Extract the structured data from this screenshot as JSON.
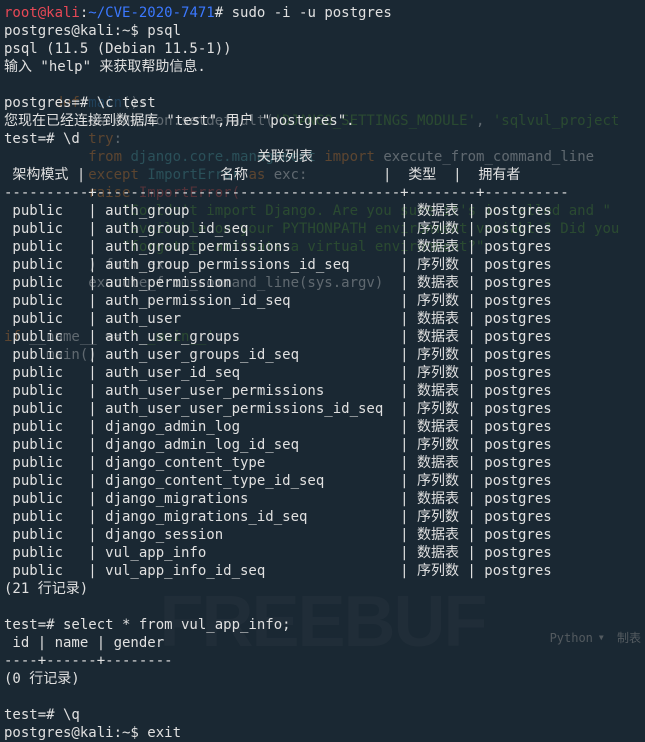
{
  "prompt": {
    "user": "root@kali",
    "sep1": ":",
    "cwd": "~/CVE-2020-7471",
    "sep2": "#",
    "cmd": " sudo -i -u postgres"
  },
  "lines": {
    "l2": "postgres@kali:~$ psql",
    "l3": "psql (11.5 (Debian 11.5-1))",
    "l4": "输入 \"help\" 来获取帮助信息.",
    "l5": "",
    "l6": "postgres=# \\c test",
    "l7": "您现在已经连接到数据库 \"test\",用户 \"postgres\".",
    "l8": "test=# \\d",
    "l9": "                              关联列表",
    "l10": " 架构模式 |                名称                |  类型  |  拥有者  ",
    "l11": "----------+------------------------------------+--------+----------"
  },
  "table": [
    [
      " public   | auth_group                         | 数据表 | postgres"
    ],
    [
      " public   | auth_group_id_seq                  | 序列数 | postgres"
    ],
    [
      " public   | auth_group_permissions             | 数据表 | postgres"
    ],
    [
      " public   | auth_group_permissions_id_seq      | 序列数 | postgres"
    ],
    [
      " public   | auth_permission                    | 数据表 | postgres"
    ],
    [
      " public   | auth_permission_id_seq             | 序列数 | postgres"
    ],
    [
      " public   | auth_user                          | 数据表 | postgres"
    ],
    [
      " public   | auth_user_groups                   | 数据表 | postgres"
    ],
    [
      " public   | auth_user_groups_id_seq            | 序列数 | postgres"
    ],
    [
      " public   | auth_user_id_seq                   | 序列数 | postgres"
    ],
    [
      " public   | auth_user_user_permissions         | 数据表 | postgres"
    ],
    [
      " public   | auth_user_user_permissions_id_seq  | 序列数 | postgres"
    ],
    [
      " public   | django_admin_log                   | 数据表 | postgres"
    ],
    [
      " public   | django_admin_log_id_seq            | 序列数 | postgres"
    ],
    [
      " public   | django_content_type                | 数据表 | postgres"
    ],
    [
      " public   | django_content_type_id_seq         | 序列数 | postgres"
    ],
    [
      " public   | django_migrations                  | 数据表 | postgres"
    ],
    [
      " public   | django_migrations_id_seq           | 序列数 | postgres"
    ],
    [
      " public   | django_session                     | 数据表 | postgres"
    ],
    [
      " public   | vul_app_info                       | 数据表 | postgres"
    ],
    [
      " public   | vul_app_info_id_seq                | 序列数 | postgres"
    ]
  ],
  "after": {
    "a1": "(21 行记录)",
    "a2": "",
    "a3": "test=# select * from vul_app_info;",
    "a4": " id | name | gender ",
    "a5": "----+------+--------",
    "a6": "(0 行记录)",
    "a7": "",
    "a8": "test=# \\q",
    "a9": "postgres@kali:~$ exit"
  },
  "ghost": {
    "g1": "",
    "g2": "",
    "g3": "",
    "g4": "",
    "g5_pre": "      ",
    "g5_kw": "def ",
    "g5_fn": "main",
    "g5_post": "():",
    "g6_a": "          os.environ.setdefault(",
    "g6_s1": "'DJANGO_SETTINGS_MODULE'",
    "g6_b": ", ",
    "g6_s2": "'sqlvul_project",
    "g7_a": "          ",
    "g7_kw": "try",
    "g7_b": ":",
    "g8_a": "          ",
    "g8_kw": "from ",
    "g8_b": "django.core.management ",
    "g8_kw2": "import",
    "g8_c": " execute_from_command_line",
    "g9_a": "          ",
    "g9_kw": "except ",
    "g9_b": "ImportError ",
    "g9_kw2": "as",
    "g9_c": " exc:",
    "g10_a": "          ",
    "g10_kw": "raise ",
    "g10_b": "ImportError(",
    "g11": "              \"Couldn't import Django. Are you sure it's installed and \"",
    "g12": "              \"available on your PYTHONPATH environment variable? Did you",
    "g13": "              \"forget to activate a virtual environment?\"",
    "g14": "          ) from exc",
    "g15": "          execute_from_command_line(sys.argv)",
    "g18_kw": "if",
    "g18_a": " __name__ == ",
    "g18_s": "'__main__'",
    "g18_b": ":",
    "g19": "     main()"
  },
  "watermark": "FREEBUF",
  "status": {
    "lang": "Python",
    "extra": "制表"
  }
}
